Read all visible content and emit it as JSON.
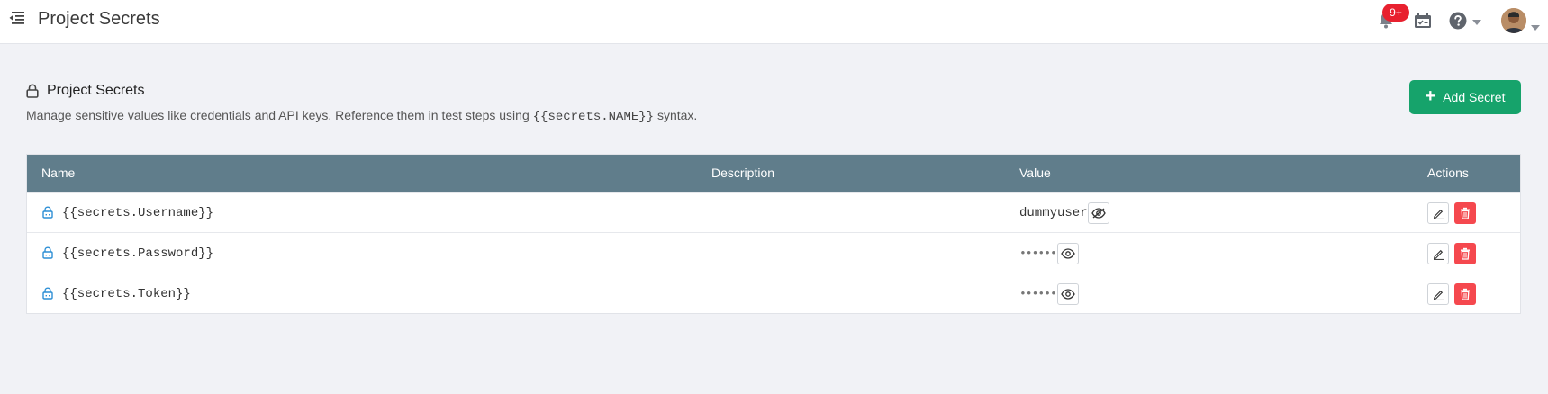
{
  "topbar": {
    "title": "Project Secrets",
    "notification_count": "9+",
    "icons": [
      "menu-toggle-icon",
      "bell-icon",
      "calendar-icon",
      "help-icon",
      "avatar"
    ]
  },
  "header": {
    "title": "Project Secrets",
    "description_prefix": "Manage sensitive values like credentials and API keys. Reference them in test steps using ",
    "description_code": "{{secrets.NAME}}",
    "description_suffix": " syntax.",
    "add_button_label": "Add Secret"
  },
  "table": {
    "columns": [
      "Name",
      "Description",
      "Value",
      "Actions"
    ],
    "rows": [
      {
        "name": "{{secrets.Username}}",
        "description": "",
        "value": "dummyuser",
        "revealed": true
      },
      {
        "name": "{{secrets.Password}}",
        "description": "",
        "value": "••••••••",
        "revealed": false
      },
      {
        "name": "{{secrets.Token}}",
        "description": "",
        "value": "••••••••",
        "revealed": false
      }
    ]
  },
  "colors": {
    "accent_green": "#16a36b",
    "table_header": "#607d8b",
    "danger": "#f5484e",
    "badge": "#e8212f",
    "lock_blue": "#2d8fd5"
  }
}
